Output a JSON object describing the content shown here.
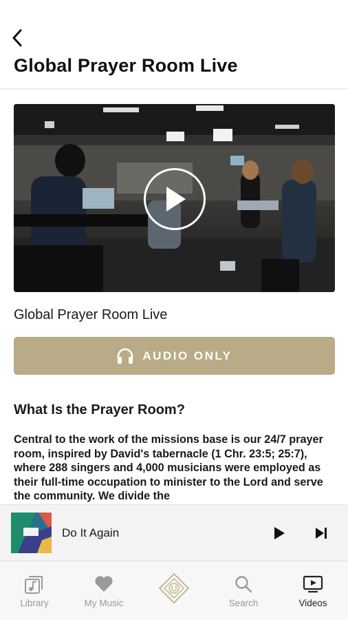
{
  "header": {
    "title": "Global Prayer Room Live",
    "back_icon": "chevron-left-icon"
  },
  "video": {
    "title": "Global Prayer Room Live",
    "play_icon": "play-icon"
  },
  "audio_button": {
    "label": "AUDIO ONLY",
    "icon": "headphones-icon",
    "color": "#b9ab87"
  },
  "section": {
    "heading": "What Is the Prayer Room?",
    "body": "Central to the work of the missions base is our 24/7 prayer room, inspired by David's tabernacle (1 Chr. 23:5; 25:7), where 288 singers and 4,000 musicians were employed as their full-time occupation to minister to the Lord and serve the community. We divide the"
  },
  "mini_player": {
    "track_title": "Do It Again",
    "play_icon": "play-icon",
    "next_icon": "skip-next-icon"
  },
  "tabbar": {
    "items": [
      {
        "label": "Library",
        "icon": "music-library-icon"
      },
      {
        "label": "My Music",
        "icon": "heart-icon"
      },
      {
        "label": "",
        "icon": "logo-diamond-icon"
      },
      {
        "label": "Search",
        "icon": "search-icon"
      },
      {
        "label": "Videos",
        "icon": "video-play-icon",
        "active": true
      }
    ]
  }
}
